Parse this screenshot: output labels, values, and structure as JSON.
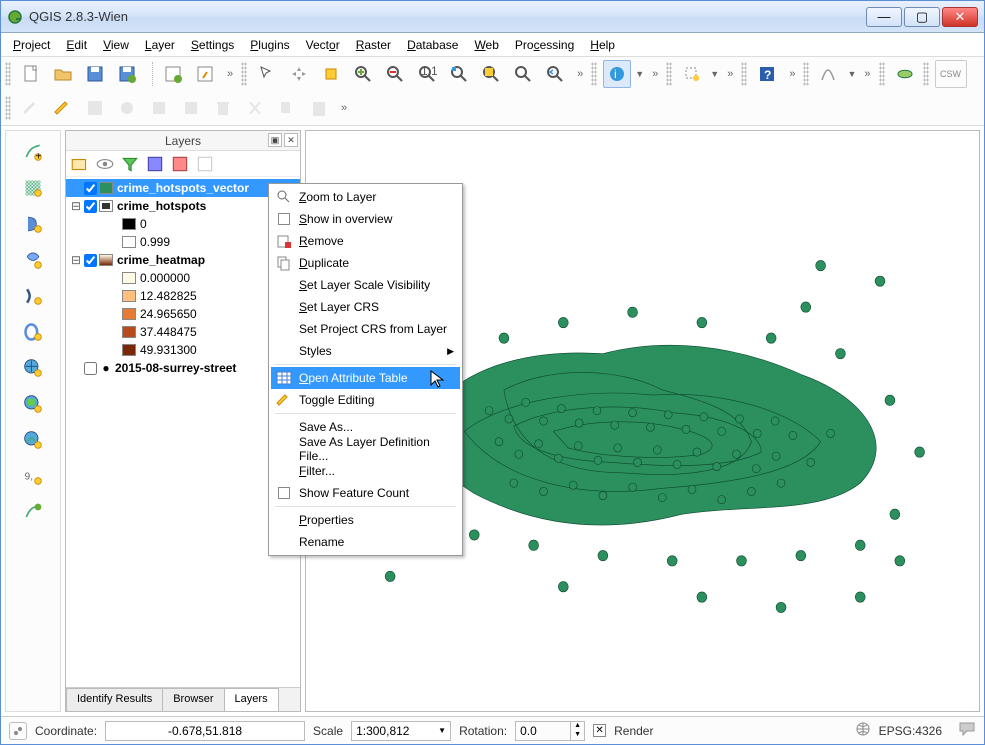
{
  "window": {
    "title": "QGIS 2.8.3-Wien"
  },
  "menubar": {
    "project": "Project",
    "edit": "Edit",
    "view": "View",
    "layer": "Layer",
    "settings": "Settings",
    "plugins": "Plugins",
    "vector": "Vector",
    "raster": "Raster",
    "database": "Database",
    "web": "Web",
    "processing": "Processing",
    "help": "Help"
  },
  "panel": {
    "title": "Layers",
    "tabs": {
      "identify": "Identify Results",
      "browser": "Browser",
      "layers": "Layers"
    }
  },
  "layers": {
    "vector": {
      "name": "crime_hotspots_vector"
    },
    "hotspots": {
      "name": "crime_hotspots",
      "classes": [
        "0",
        "0.999"
      ]
    },
    "heatmap": {
      "name": "crime_heatmap",
      "classes": [
        "0.000000",
        "12.482825",
        "24.965650",
        "37.448475",
        "49.931300"
      ]
    },
    "points": {
      "name": "2015-08-surrey-street"
    }
  },
  "context_menu": {
    "zoom_to_layer": "Zoom to Layer",
    "show_in_overview": "Show in overview",
    "remove": "Remove",
    "duplicate": "Duplicate",
    "set_scale_visibility": "Set Layer Scale Visibility",
    "set_layer_crs": "Set Layer CRS",
    "set_project_crs": "Set Project CRS from Layer",
    "styles": "Styles",
    "open_attribute_table": "Open Attribute Table",
    "toggle_editing": "Toggle Editing",
    "save_as": "Save As...",
    "save_as_layerdef": "Save As Layer Definition File...",
    "filter": "Filter...",
    "show_feature_count": "Show Feature Count",
    "properties": "Properties",
    "rename": "Rename"
  },
  "statusbar": {
    "coord_label": "Coordinate:",
    "coord_value": "-0.678,51.818",
    "scale_label": "Scale",
    "scale_value": "1:300,812",
    "rotation_label": "Rotation:",
    "rotation_value": "0.0",
    "render_label": "Render",
    "crs": "EPSG:4326"
  },
  "colors": {
    "accent": "#3399ff",
    "cluster": "#2b8f5e"
  }
}
